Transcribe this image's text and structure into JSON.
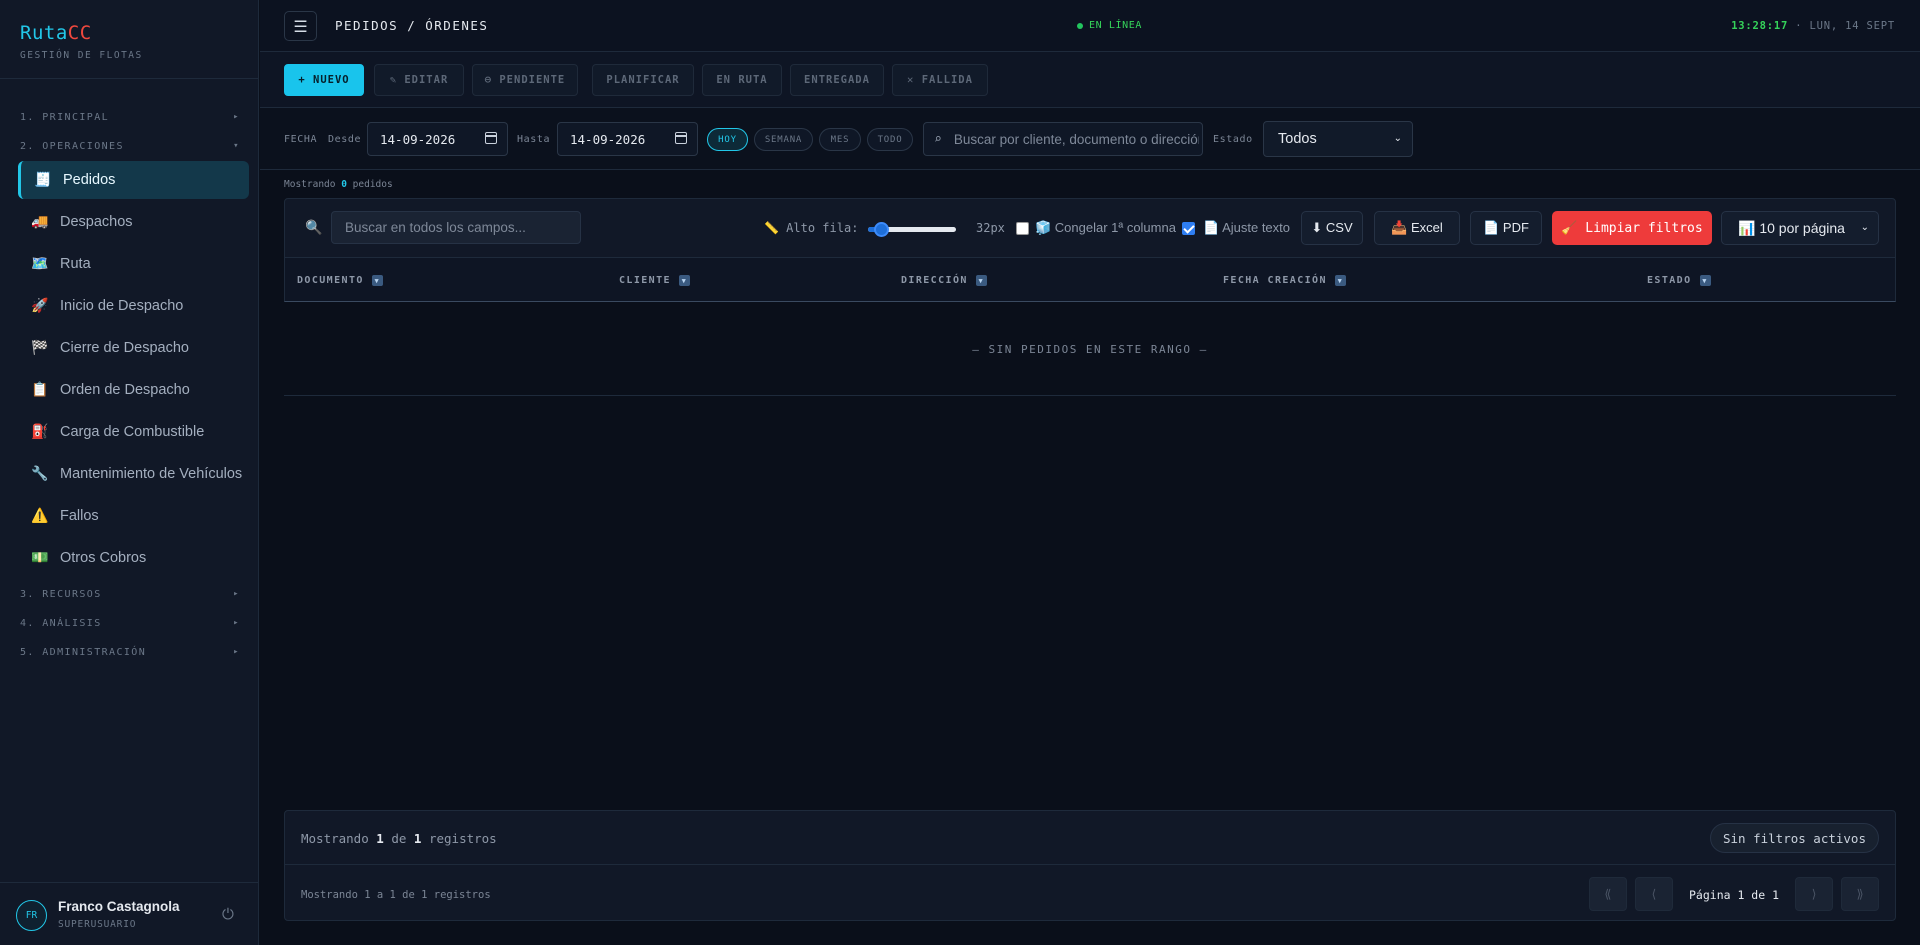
{
  "brand": {
    "name_a": "Ruta",
    "name_b": "CC",
    "subtitle": "GESTIÓN DE FLOTAS"
  },
  "sidebar": {
    "sections": [
      {
        "label": "1. PRINCIPAL",
        "arrow": "▸"
      },
      {
        "label": "2. OPERACIONES",
        "arrow": "▾"
      },
      {
        "label": "3. RECURSOS",
        "arrow": "▸"
      },
      {
        "label": "4. ANÁLISIS",
        "arrow": "▸"
      },
      {
        "label": "5. ADMINISTRACIÓN",
        "arrow": "▸"
      }
    ],
    "items": [
      {
        "label": "Pedidos",
        "icon": "🧾",
        "icon_name": "receipt-icon",
        "active": true
      },
      {
        "label": "Despachos",
        "icon": "🚚",
        "icon_name": "truck-icon"
      },
      {
        "label": "Ruta",
        "icon": "🗺️",
        "icon_name": "map-icon"
      },
      {
        "label": "Inicio de Despacho",
        "icon": "🚀",
        "icon_name": "rocket-icon"
      },
      {
        "label": "Cierre de Despacho",
        "icon": "🏁",
        "icon_name": "checkered-flag-icon"
      },
      {
        "label": "Orden de Despacho",
        "icon": "📋",
        "icon_name": "clipboard-icon"
      },
      {
        "label": "Carga de Combustible",
        "icon": "⛽",
        "icon_name": "fuel-icon"
      },
      {
        "label": "Mantenimiento de Vehículos",
        "icon": "🔧",
        "icon_name": "wrench-icon"
      },
      {
        "label": "Fallos",
        "icon": "⚠️",
        "icon_name": "warning-icon"
      },
      {
        "label": "Otros Cobros",
        "icon": "💵",
        "icon_name": "money-icon"
      }
    ],
    "user": {
      "initials": "FR",
      "name": "Franco Castagnola",
      "role": "SUPERUSUARIO",
      "power_icon": "⏻"
    }
  },
  "topbar": {
    "menu_icon": "☰",
    "breadcrumb": "PEDIDOS / ÓRDENES",
    "status": "EN LÍNEA",
    "time": "13:28:17",
    "date": " · LUN, 14 SEPT"
  },
  "toolbar": {
    "nuevo": "+ NUEVO",
    "editar": "✎ EDITAR",
    "pendiente": "⊖ PENDIENTE",
    "planificar": "PLANIFICAR",
    "en_ruta": "EN RUTA",
    "entregada": "ENTREGADA",
    "fallida": "✕ FALLIDA"
  },
  "filters": {
    "fecha_label": "FECHA",
    "desde_label": "Desde",
    "desde_value": "14-09-2026",
    "hasta_label": "Hasta",
    "hasta_value": "14-09-2026",
    "pills": [
      "HOY",
      "SEMANA",
      "MES",
      "TODO"
    ],
    "search_icon": "⌕",
    "search_placeholder": "Buscar por cliente, documento o dirección",
    "estado_label": "Estado",
    "estado_value": "Todos"
  },
  "summary": {
    "prefix": "Mostrando ",
    "count": "0",
    "suffix": " pedidos"
  },
  "table": {
    "search_placeholder": "Buscar en todos los campos...",
    "row_height_label": "📏 Alto fila:",
    "row_height_value": "32px",
    "row_height_level": 0.15,
    "freeze_label": "🧊 Congelar 1ª columna",
    "freeze_checked": false,
    "wrap_label": "📄 Ajuste texto",
    "wrap_checked": true,
    "csv": "⬇ CSV",
    "excel": "📥 Excel",
    "pdf": "📄 PDF",
    "clear": "🧹 Limpiar filtros",
    "per_page": "📊 10 por página",
    "columns": [
      "DOCUMENTO",
      "CLIENTE",
      "DIRECCIÓN",
      "FECHA CREACIÓN",
      "ESTADO"
    ],
    "filter_icon": "▼",
    "empty": "— SIN PEDIDOS EN ESTE RANGO —"
  },
  "footer": {
    "info1_a": "Mostrando ",
    "info1_b": "1",
    "info1_c": " de ",
    "info1_d": "1",
    "info1_e": " registros",
    "no_filters": "Sin filtros activos",
    "info2": "Mostrando 1 a 1 de 1 registros",
    "first": "⟪",
    "prev": "⟨",
    "page": "Página 1 de 1",
    "next": "⟩",
    "last": "⟫"
  },
  "colors": {
    "accent": "#22c7e8",
    "danger": "#ee3b3b",
    "online": "#35d35a",
    "bg": "#0a0f1a"
  }
}
